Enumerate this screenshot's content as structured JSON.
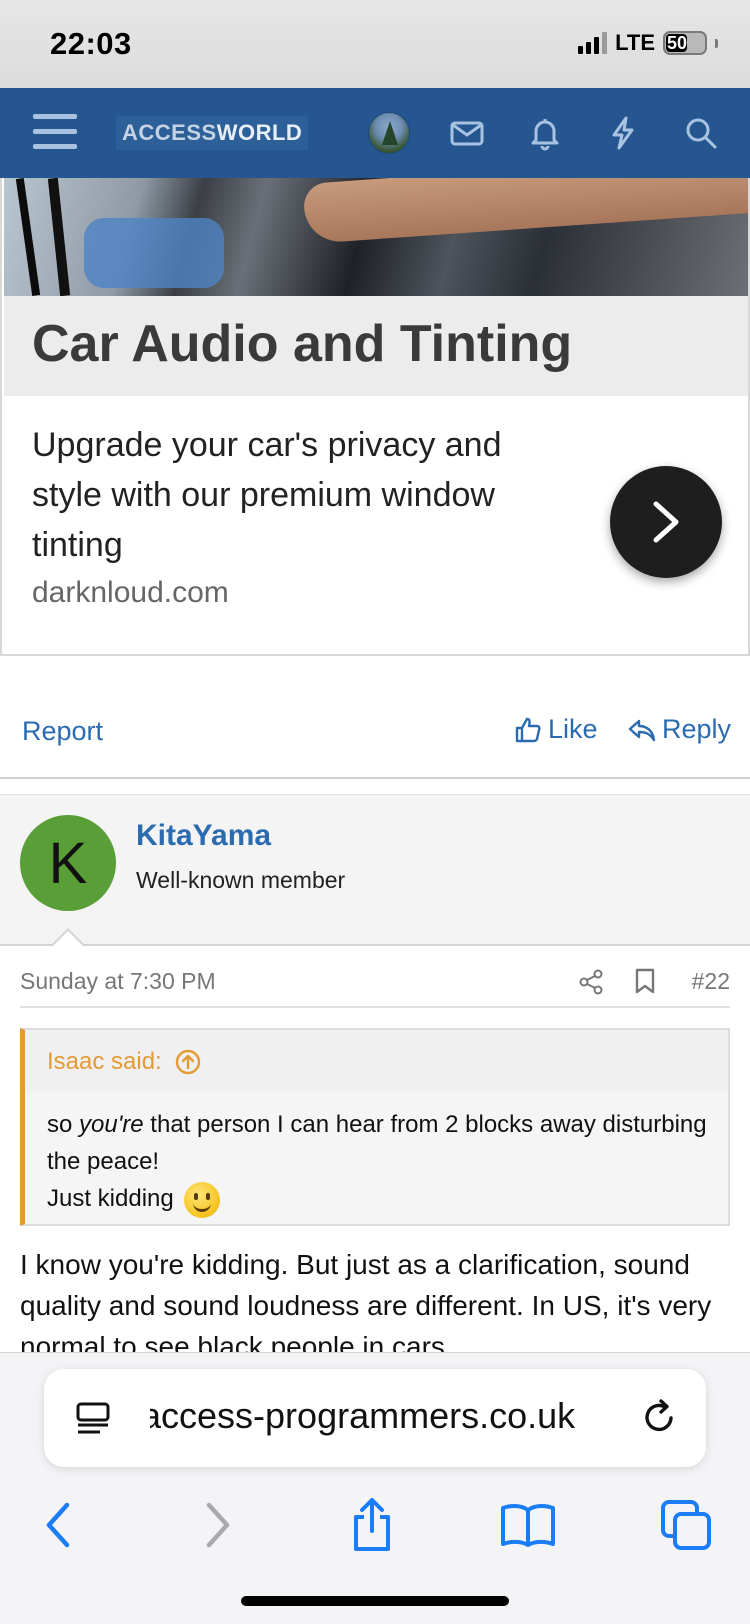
{
  "status_bar": {
    "time": "22:03",
    "network": "LTE",
    "battery": "50"
  },
  "header": {
    "logo_prefix": "ACCESS",
    "logo_suffix": "WORLD"
  },
  "ad": {
    "title": "Car Audio and Tinting",
    "description": "Upgrade your car's privacy and style with our premium window tinting",
    "domain": "darknloud.com"
  },
  "post_actions": {
    "report": "Report",
    "like": "Like",
    "reply": "Reply"
  },
  "user": {
    "initial": "K",
    "name": "KitaYama",
    "title": "Well-known member"
  },
  "post": {
    "date": "Sunday at 7:30 PM",
    "number": "#22",
    "quote_author": "Isaac said:",
    "quote_line1_pre": "so ",
    "quote_line1_em": "you're",
    "quote_line1_post": " that person I can hear from 2 blocks away disturbing the peace!",
    "quote_line2": "Just kidding",
    "body": "I know you're kidding. But just as a clarification, sound quality and sound loudness are different. In US, it's very normal to see black people in cars"
  },
  "browser": {
    "url": "access-programmers.co.uk"
  },
  "colors": {
    "header_bg": "#25568f",
    "link": "#2b6bb0",
    "quote_accent": "#e39a37",
    "avatar_bg": "#5a9e37",
    "ios_blue": "#1a7cf6"
  }
}
